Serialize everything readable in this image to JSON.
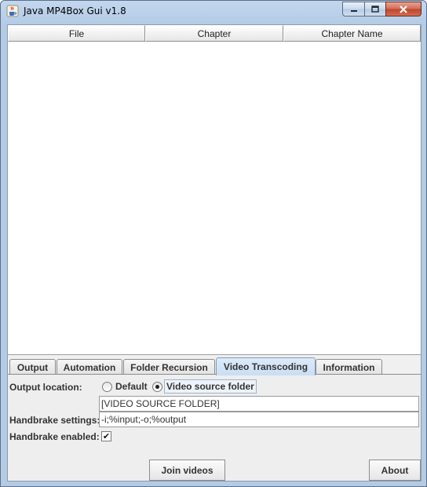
{
  "window": {
    "title": "Java MP4Box Gui v1.8",
    "icon": "java-cup-icon",
    "controls": {
      "minimize": "minimize-icon",
      "maximize": "maximize-icon",
      "close": "close-icon"
    }
  },
  "table": {
    "columns": [
      "File",
      "Chapter",
      "Chapter Name"
    ],
    "rows": []
  },
  "tabs": [
    {
      "label": "Output",
      "active": false
    },
    {
      "label": "Automation",
      "active": false
    },
    {
      "label": "Folder Recursion",
      "active": false
    },
    {
      "label": "Video Transcoding",
      "active": true
    },
    {
      "label": "Information",
      "active": false
    }
  ],
  "video_transcoding": {
    "output_location_label": "Output location:",
    "option_default": "Default",
    "option_video_source": "Video source folder",
    "selected_option": "Video source folder",
    "folder_value": "[VIDEO SOURCE FOLDER]",
    "handbrake_settings_label": "Handbrake settings:",
    "handbrake_settings_value": "-i;%input;-o;%output",
    "handbrake_enabled_label": "Handbrake enabled:",
    "handbrake_enabled": true
  },
  "buttons": {
    "join": "Join videos",
    "about": "About"
  }
}
